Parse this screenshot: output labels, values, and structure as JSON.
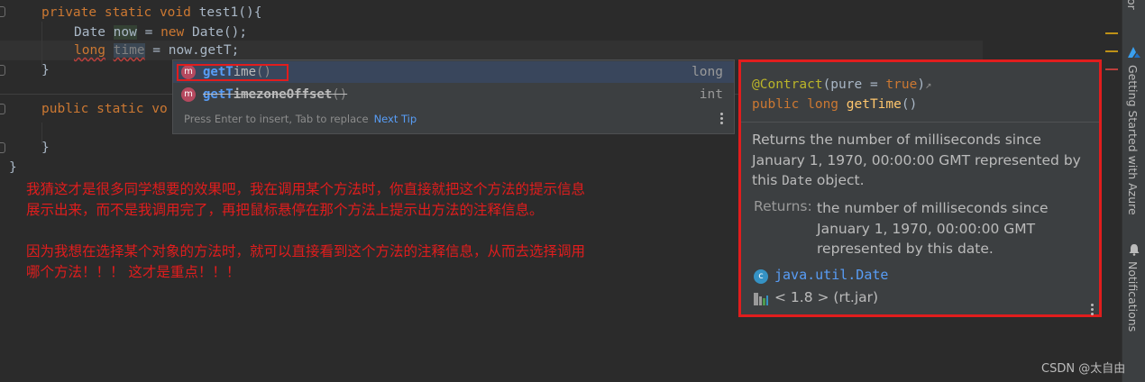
{
  "editor": {
    "lines": {
      "l1": {
        "kw": "private static void ",
        "rest": "test1(){"
      },
      "l2_a": "Date ",
      "l2_var": "now",
      "l2_b": " = ",
      "l2_kw": "new",
      "l2_c": " Date();",
      "l3_kw": "long",
      "l3_sp": " ",
      "l3_var": "time",
      "l3_b": " = now.getT;",
      "l4": "}",
      "l5_kw": "public static vo",
      "l6": "}",
      "l7": "}"
    }
  },
  "completion": {
    "items": [
      {
        "match": "getT",
        "rest": "ime",
        "params": "()",
        "type": "long"
      },
      {
        "match": "getT",
        "rest": "imezoneOffset",
        "params": "()",
        "type": "int"
      }
    ],
    "footer_hint": "Press Enter to insert, Tab to replace",
    "footer_link": "Next Tip",
    "method_icon_letter": "m"
  },
  "annotation": {
    "line1": "我猜这才是很多同学想要的效果吧，我在调用某个方法时，你直接就把这个方法的提示信息",
    "line2": "展示出来，而不是我调用完了，再把鼠标悬停在那个方法上提示出方法的注释信息。",
    "line3": "因为我想在选择某个对象的方法时，就可以直接看到这个方法的注释信息，从而去选择调用",
    "line4": "哪个方法！！！ 这才是重点！！！"
  },
  "doc": {
    "annotation_name": "@Contract",
    "annotation_open": "(pure = ",
    "annotation_value": "true",
    "annotation_close": ")",
    "external_arrow": "↗",
    "sig_kw": "public long ",
    "sig_name": "getTime",
    "sig_params": "()",
    "desc_1": "Returns the number of milliseconds since",
    "desc_2": "January 1, 1970, 00:00:00 GMT represented by",
    "desc_3a": "this ",
    "desc_3_code": "Date",
    "desc_3b": " object.",
    "returns_label": "Returns:",
    "returns_1": "the number of milliseconds since",
    "returns_2": "January 1, 1970, 00:00:00 GMT",
    "returns_3": "represented by this date.",
    "class_icon_letter": "c",
    "class_name": "java.util.Date",
    "library": "< 1.8 > (rt.jar)"
  },
  "toolwindows": {
    "top_partial": "or",
    "getting_started": "Getting Started with Azure",
    "notifications": "Notifications"
  },
  "watermark": "CSDN @太自由",
  "colors": {
    "annotation_red": "#e11d1d",
    "keyword": "#cc7832",
    "link": "#589df6",
    "method_icon": "#b5495f",
    "class_icon": "#3592c4"
  }
}
